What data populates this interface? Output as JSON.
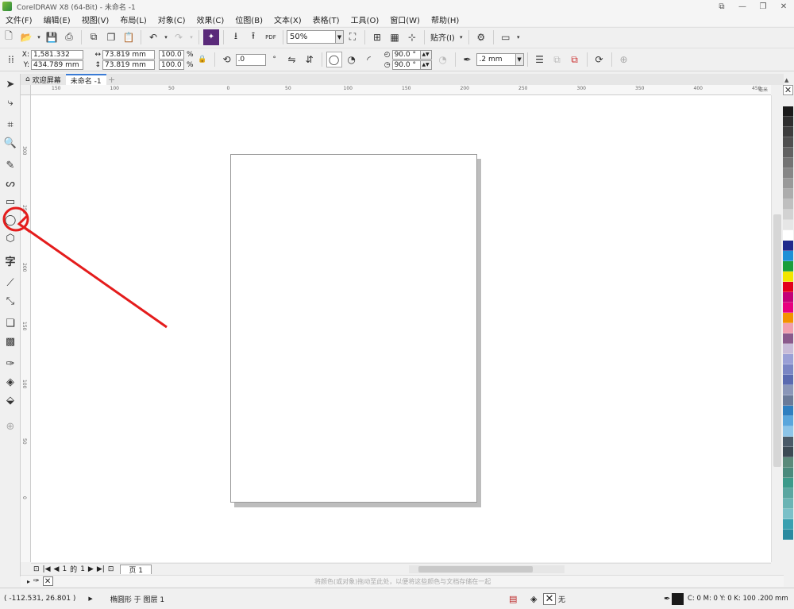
{
  "window": {
    "title": "CorelDRAW X8 (64-Bit) - 未命名 -1",
    "controls": [
      "⧉",
      "—",
      "❐",
      "✕"
    ]
  },
  "menu": [
    "文件(F)",
    "编辑(E)",
    "视图(V)",
    "布局(L)",
    "对象(C)",
    "效果(C)",
    "位图(B)",
    "文本(X)",
    "表格(T)",
    "工具(O)",
    "窗口(W)",
    "帮助(H)"
  ],
  "toolbar": {
    "zoom": "50%",
    "snap_label": "贴齐(I)"
  },
  "properties": {
    "x": "1,581.332 mm",
    "y": "434.789 mm",
    "width": "73.819 mm",
    "height": "73.819 mm",
    "scale_x": "100.0",
    "scale_y": "100.0",
    "pct": "%",
    "x_label": "X:",
    "y_label": "Y:",
    "rotation": ".0",
    "start_angle": "90.0 °",
    "end_angle": "90.0 °",
    "outline_width": ".2 mm"
  },
  "tabs": {
    "welcome": "欢迎屏幕",
    "doc": "未命名 -1",
    "add": "+"
  },
  "ruler": {
    "h_labels": [
      "150",
      "100",
      "50",
      "0",
      "50",
      "100",
      "150",
      "200",
      "250",
      "300",
      "350",
      "400",
      "450"
    ],
    "h_unit": "毫米",
    "v_labels": [
      "300",
      "250",
      "200",
      "150",
      "100",
      "50",
      "0"
    ]
  },
  "page_nav": {
    "current": "1",
    "of": "的",
    "total": "1",
    "page_tab": "页 1"
  },
  "doc_palette_hint": "将颜色(或对象)拖动至此处，以便将这些颜色与文档存储在一起",
  "status": {
    "coords": "( -112.531, 26.801 )",
    "object_info": "椭圆形 于 图层 1",
    "fill_none": "无",
    "outline_info": "C: 0 M: 0 Y: 0 K: 100  .200 mm"
  },
  "palette_colors": [
    "#1a1a1a",
    "#2e2e2e",
    "#3d3d3d",
    "#4f4f4f",
    "#616161",
    "#737373",
    "#868686",
    "#999999",
    "#acacac",
    "#bfbfbf",
    "#d2d2d2",
    "#e6e6e6",
    "#ffffff",
    "#1f2a8c",
    "#1e90d6",
    "#1a9e3b",
    "#f2e600",
    "#e3001b",
    "#c40078",
    "#e8007f",
    "#f39200",
    "#f0a0b0",
    "#8a5a8c",
    "#c8bcd8",
    "#9aa0d6",
    "#7a86c4",
    "#5a6ab0",
    "#8a96b8",
    "#6a7a98",
    "#2f7fc0",
    "#5aa6dc",
    "#8cc4e8",
    "#4a5a68",
    "#3c4a54",
    "#5a8a7a",
    "#4a8a7c",
    "#3c9a8a",
    "#5aa6a0",
    "#6ab4b4",
    "#7ac0c8",
    "#3aa0b0",
    "#2a8aa0"
  ]
}
